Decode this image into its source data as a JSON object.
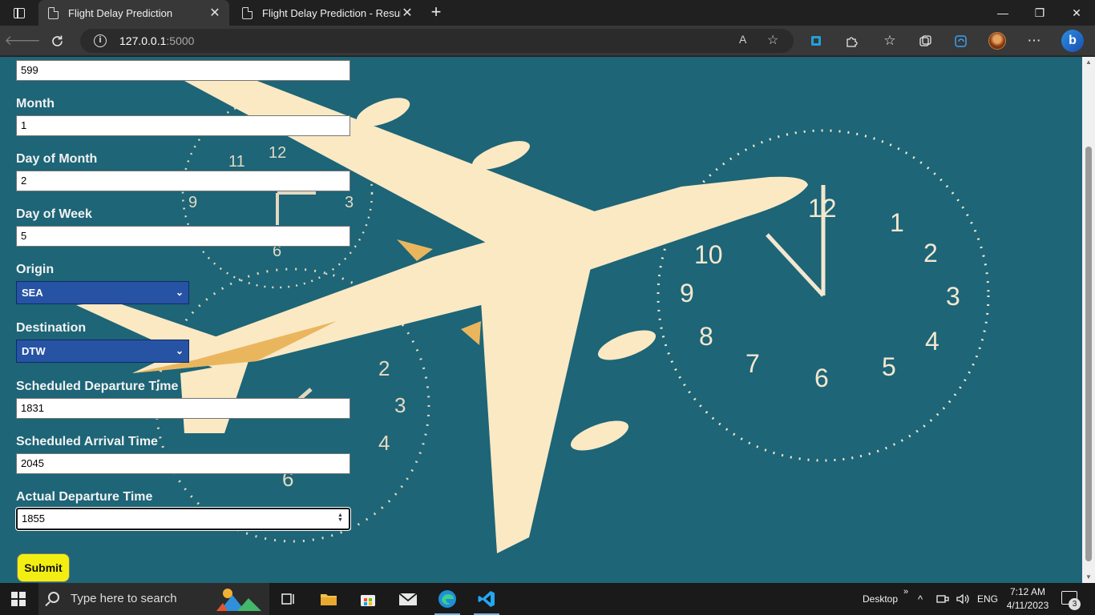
{
  "browser": {
    "tabs": [
      {
        "title": "Flight Delay Prediction",
        "active": true
      },
      {
        "title": "Flight Delay Prediction - Result",
        "active": false
      }
    ],
    "url_host": "127.0.0.1",
    "url_port": ":5000",
    "window_controls": {
      "minimize": "—",
      "restore": "❐",
      "close": "✕"
    }
  },
  "form": {
    "top_field_value": "599",
    "fields": [
      {
        "label": "Month",
        "value": "1"
      },
      {
        "label": "Day of Month",
        "value": "2"
      },
      {
        "label": "Day of Week",
        "value": "5"
      }
    ],
    "origin": {
      "label": "Origin",
      "selected": "SEA"
    },
    "destination": {
      "label": "Destination",
      "selected": "DTW"
    },
    "times": [
      {
        "label": "Scheduled Departure Time",
        "value": "1831"
      },
      {
        "label": "Scheduled Arrival Time",
        "value": "2045"
      },
      {
        "label": "Actual Departure Time",
        "value": "1855"
      }
    ],
    "submit_label": "Submit"
  },
  "colors": {
    "page_background": "#1d6577",
    "select_background": "#2753a4",
    "submit_background": "#f3ee11",
    "plane": "#fbe9c4"
  },
  "taskbar": {
    "search_placeholder": "Type here to search",
    "desktop_label": "Desktop",
    "language": "ENG",
    "time": "7:12 AM",
    "date": "4/11/2023",
    "notification_count": "3"
  }
}
